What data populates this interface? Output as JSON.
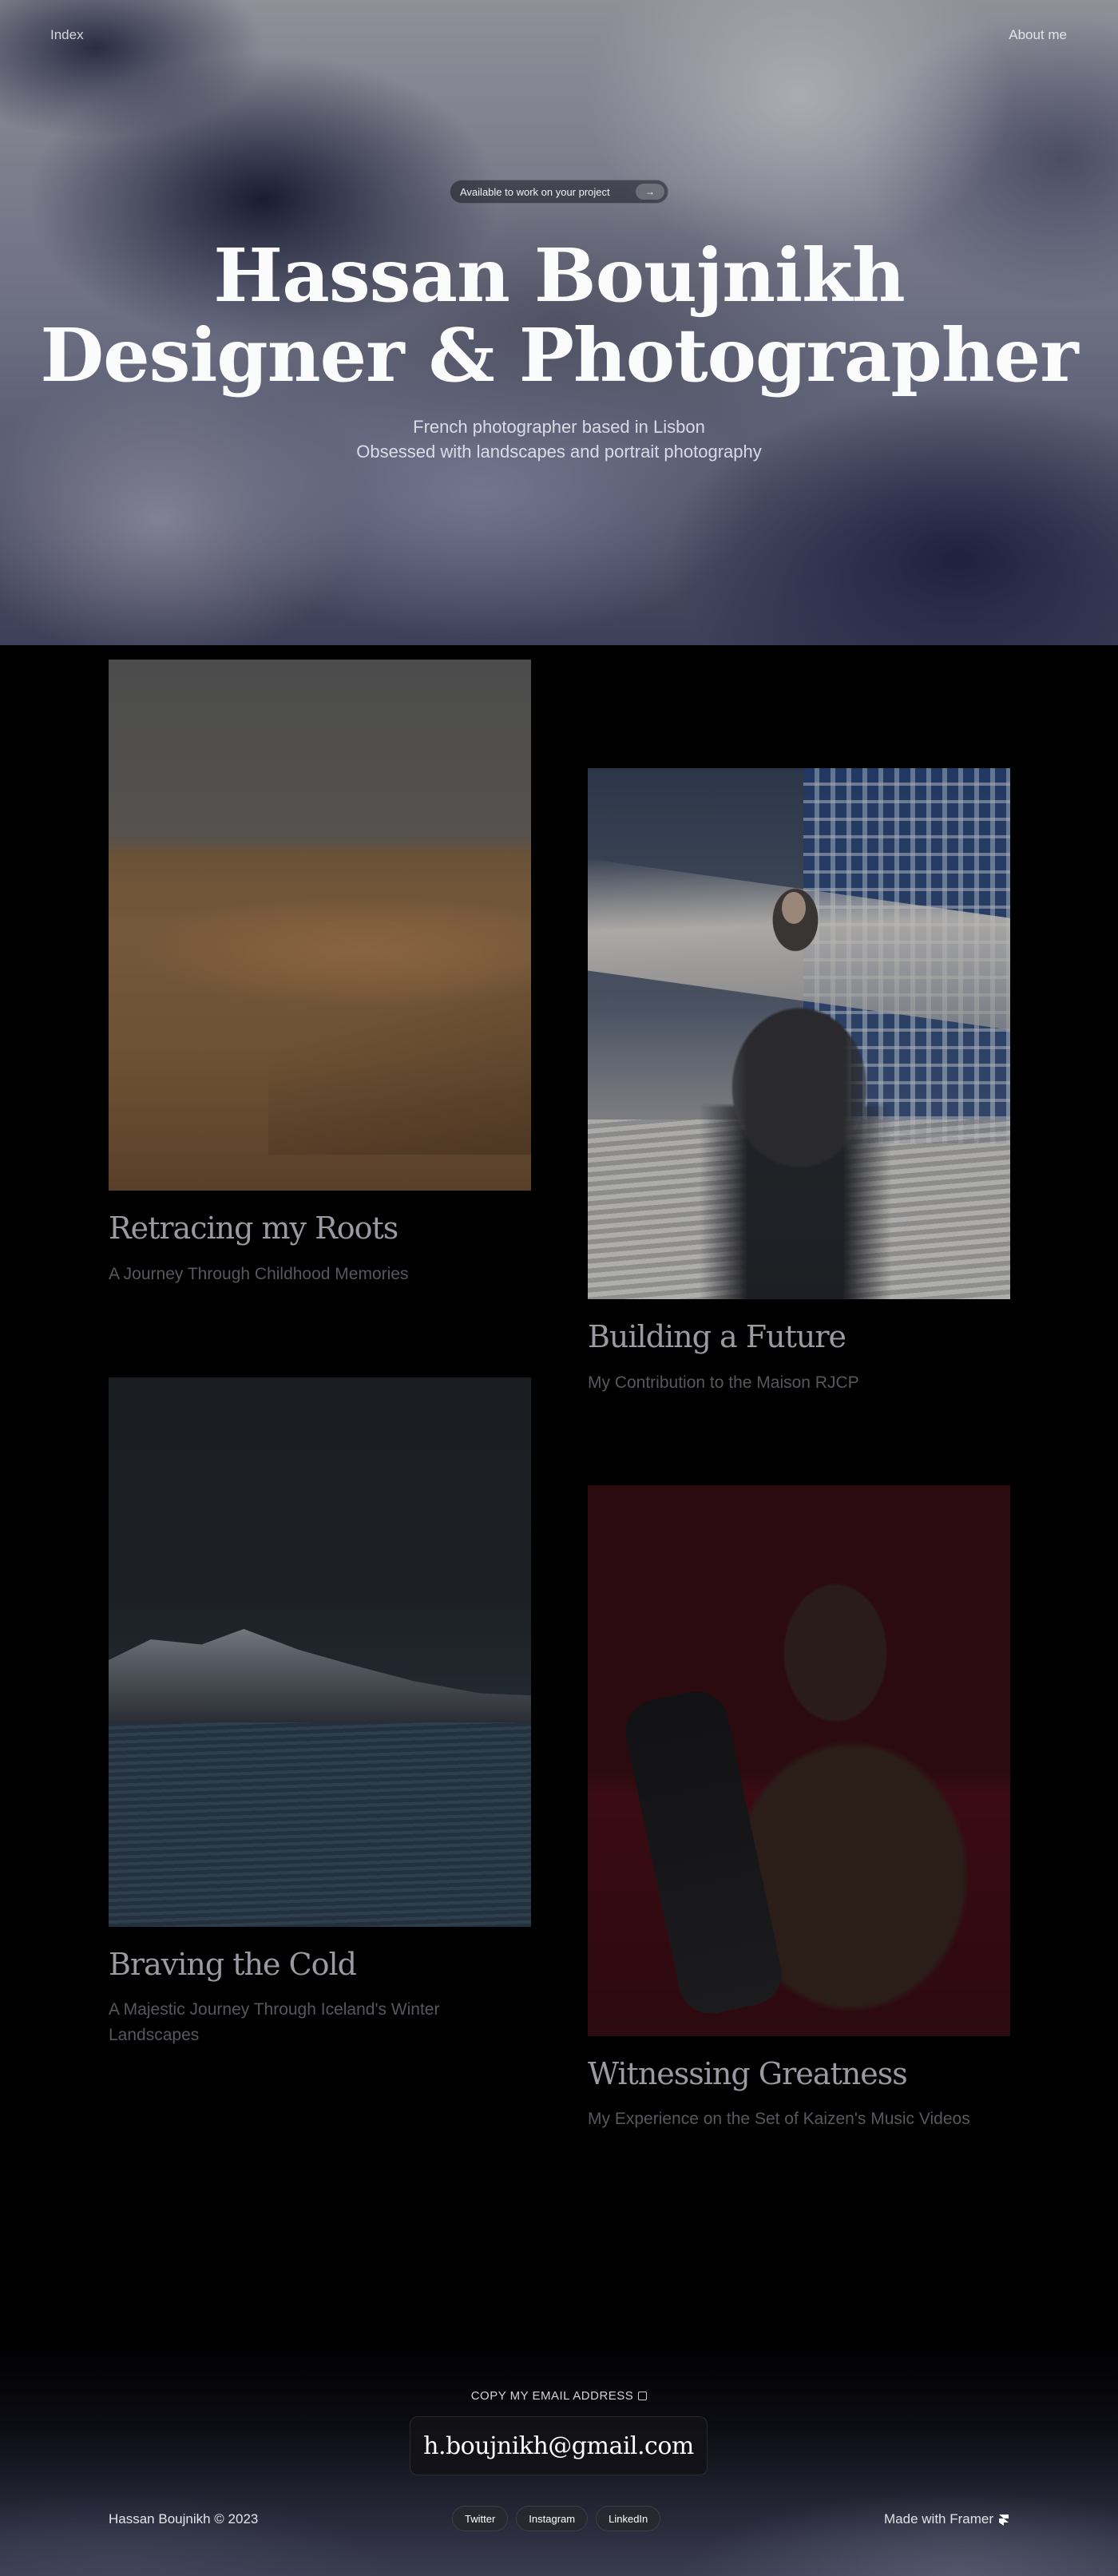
{
  "nav": {
    "index_label": "Index",
    "about_label": "About me"
  },
  "hero": {
    "availability": "Available to work on your project",
    "availability_arrow": "→",
    "title_line1": "Hassan Boujnikh",
    "title_line2": "Designer & Photographer",
    "subtitle_line1": "French photographer based in Lisbon",
    "subtitle_line2": "Obsessed with landscapes and portrait photography"
  },
  "projects": [
    {
      "title": "Retracing my Roots",
      "subtitle": "A Journey Through Childhood Memories",
      "image": "desert-dunes-photo"
    },
    {
      "title": "Building a Future",
      "subtitle": "My Contribution to the Maison RJCP",
      "image": "urban-portrait-photo"
    },
    {
      "title": "Braving the Cold",
      "subtitle": "A Majestic Journey Through Iceland's Winter Landscapes",
      "image": "iceland-sea-photo"
    },
    {
      "title": "Witnessing Greatness",
      "subtitle": "My Experience on the Set of Kaizen's Music Videos",
      "image": "red-portrait-photo"
    }
  ],
  "footer": {
    "copy_email_label": "COPY MY EMAIL ADDRESS",
    "email": "h.boujnikh@gmail.com",
    "copyright": "Hassan Boujnikh © 2023",
    "socials": [
      "Twitter",
      "Instagram",
      "LinkedIn"
    ],
    "made_with": "Made with Framer"
  },
  "colors": {
    "background": "#000000",
    "project_title": "#9c9aa0",
    "project_subtitle": "#58575d"
  }
}
